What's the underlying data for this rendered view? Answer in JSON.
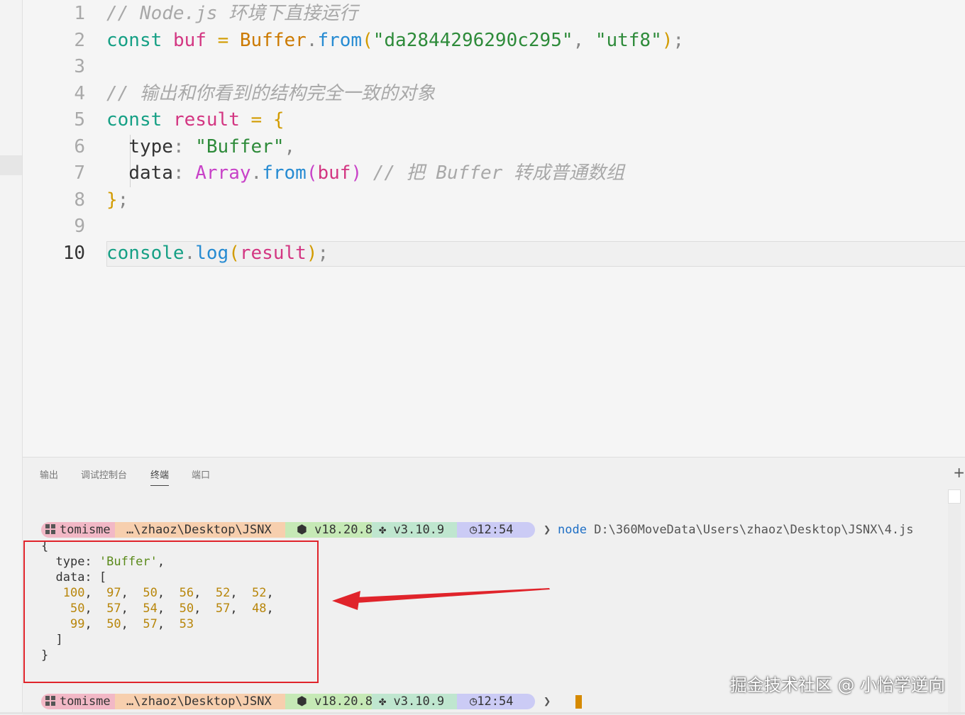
{
  "editor": {
    "line_numbers": [
      "1",
      "2",
      "3",
      "4",
      "5",
      "6",
      "7",
      "8",
      "9",
      "10"
    ],
    "line1_comment": "// Node.js 环境下直接运行",
    "line2": {
      "kw": "const",
      "var": "buf",
      "eq": "=",
      "cls": "Buffer",
      "dot": ".",
      "fn": "from",
      "open": "(",
      "str1": "\"da2844296290c295\"",
      "comma": ",",
      "str2": "\"utf8\"",
      "close": ")",
      "semi": ";"
    },
    "line4_comment": "// 输出和你看到的结构完全一致的对象",
    "line5": {
      "kw": "const",
      "var": "result",
      "eq": "=",
      "brace": "{"
    },
    "line6": {
      "prop": "type",
      "colon": ":",
      "str": "\"Buffer\"",
      "comma": ","
    },
    "line7": {
      "prop": "data",
      "colon": ":",
      "cls": "Array",
      "dot": ".",
      "fn": "from",
      "open": "(",
      "arg": "buf",
      "close": ")",
      "comment": "// 把 Buffer 转成普通数组"
    },
    "line8": {
      "brace": "}",
      "semi": ";"
    },
    "line10": {
      "obj": "console",
      "dot": ".",
      "fn": "log",
      "open": "(",
      "arg": "result",
      "close": ")",
      "semi": ";"
    }
  },
  "panel": {
    "tabs": [
      "输出",
      "调试控制台",
      "终端",
      "端口"
    ],
    "active_tab": "终端",
    "plus": "+",
    "prompt": {
      "user": "tomisme",
      "path": "…\\zhaoz\\Desktop\\JSNX",
      "node_version": "v18.20.8",
      "python_version": "v3.10.9",
      "time": "12:54",
      "chevron": "❯"
    },
    "command": {
      "program": "node",
      "args": "D:\\360MoveData\\Users\\zhaoz\\Desktop\\JSNX\\4.js"
    },
    "output": {
      "open": "{",
      "type_key": "type:",
      "type_val": "'Buffer'",
      "type_comma": ",",
      "data_key": "data: [",
      "row1": [
        "100",
        "97",
        "50",
        "56",
        "52",
        "52"
      ],
      "row2": [
        "50",
        "57",
        "54",
        "50",
        "57",
        "48"
      ],
      "row3": [
        "99",
        "50",
        "57",
        "53"
      ],
      "close_bracket": "]",
      "close": "}"
    }
  },
  "watermark": "掘金技术社区 @ 小怡学逆向",
  "colors": {
    "annotation_red": "#e0242b",
    "cursor": "#d68a00"
  }
}
